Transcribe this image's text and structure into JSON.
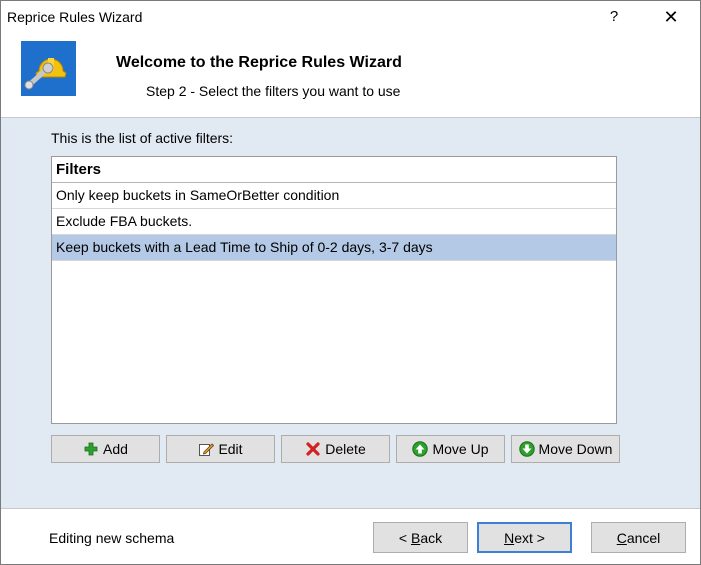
{
  "window": {
    "title": "Reprice Rules Wizard",
    "help_label": "?",
    "close_label": "✕"
  },
  "header": {
    "title": "Welcome to the Reprice Rules Wizard",
    "subtitle": "Step 2 - Select the filters you want to use",
    "logo_icon": "hardhat-wrench-icon"
  },
  "filters": {
    "intro": "This is the list of active filters:",
    "column_header": "Filters",
    "rows": [
      "Only keep buckets in SameOrBetter condition",
      "Exclude FBA buckets.",
      "Keep buckets with a Lead Time to Ship of 0-2 days, 3-7 days"
    ],
    "selected_index": 2
  },
  "actions": {
    "add": "Add",
    "edit": "Edit",
    "delete": "Delete",
    "move_up": "Move Up",
    "move_down": "Move Down"
  },
  "footer": {
    "status": "Editing new schema",
    "back_pre": "< ",
    "back_key": "B",
    "back_rest": "ack",
    "next_key": "N",
    "next_rest": "ext >",
    "cancel_key": "C",
    "cancel_rest": "ancel"
  },
  "colors": {
    "accent": "#3c7fd4",
    "selection": "#b4c9e6",
    "content_bg": "#e1e9f3"
  }
}
